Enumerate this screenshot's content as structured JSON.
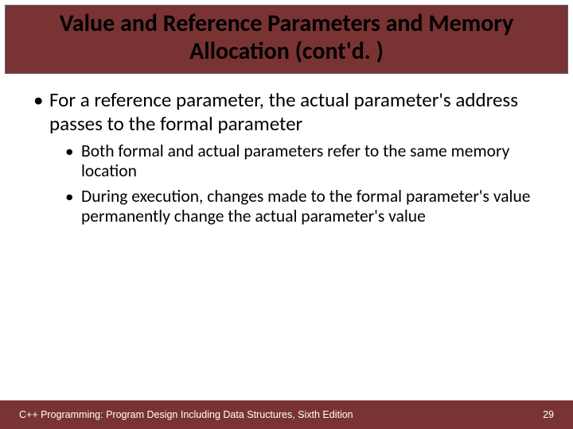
{
  "title": "Value and Reference Parameters and Memory Allocation (cont'd. )",
  "bullets": {
    "level1": [
      "For a reference parameter, the actual parameter's address passes to the formal parameter"
    ],
    "level2": [
      "Both formal and actual parameters refer to the same memory location",
      "During execution, changes made to the formal parameter's value permanently change the actual parameter's value"
    ]
  },
  "footer": {
    "text": "C++ Programming: Program Design Including Data Structures, Sixth Edition",
    "page": "29"
  }
}
